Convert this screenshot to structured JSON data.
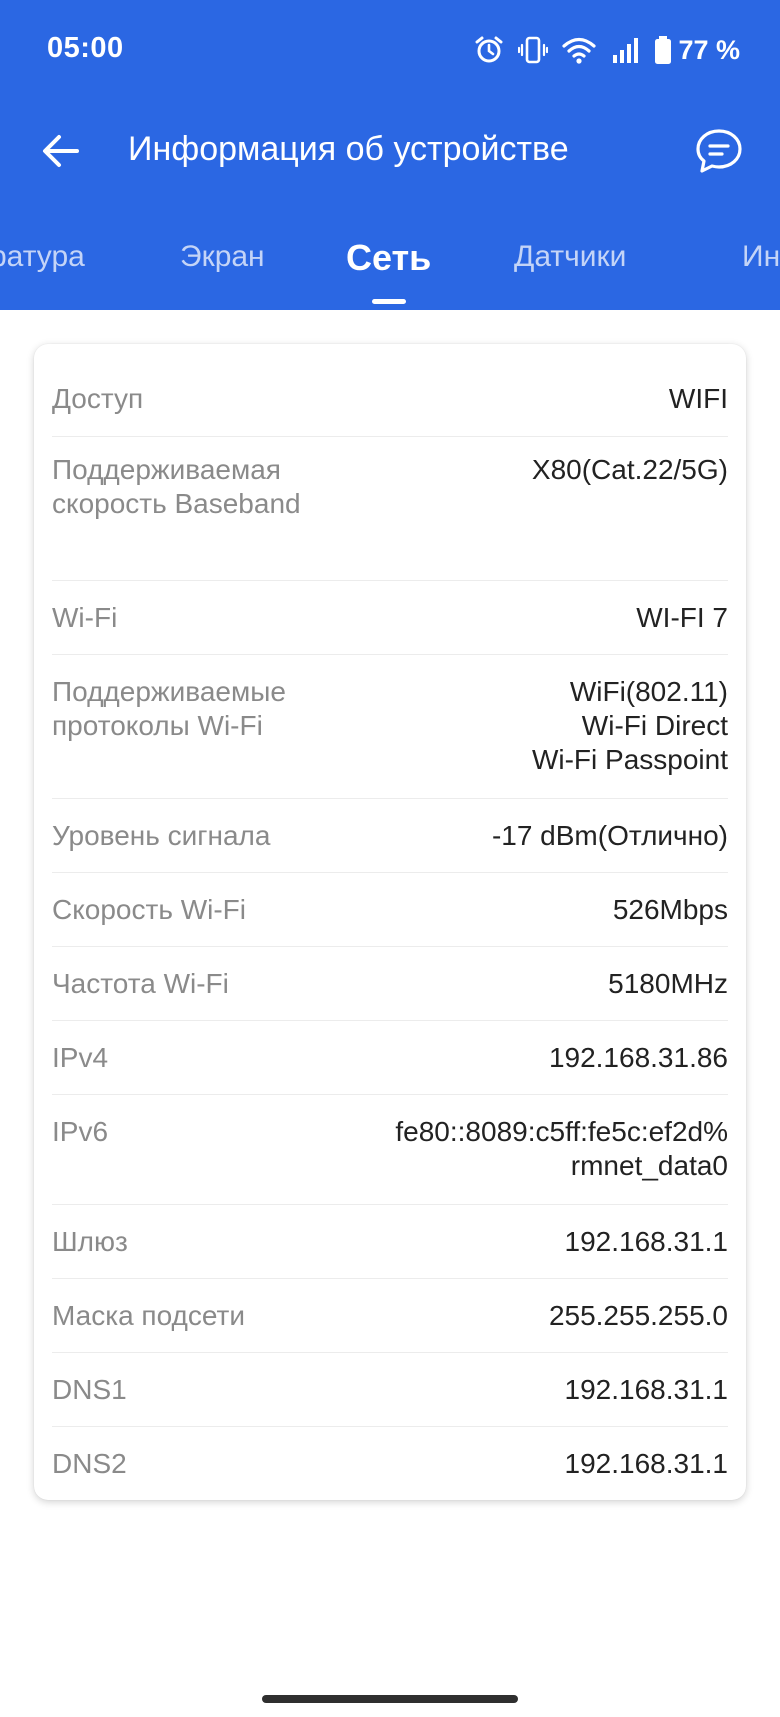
{
  "status_bar": {
    "time": "05:00",
    "battery": "77 %"
  },
  "header": {
    "title": "Информация об устройстве"
  },
  "tabs": [
    {
      "label": "ратура"
    },
    {
      "label": "Экран"
    },
    {
      "label": "Сеть"
    },
    {
      "label": "Датчики"
    },
    {
      "label": "Ин"
    }
  ],
  "active_tab": "Сеть",
  "colors": {
    "accent": "#2b67e3",
    "label_gray": "#8a8a8a",
    "value_text": "#222222"
  },
  "rows": [
    {
      "label": "Доступ",
      "value": "WIFI"
    },
    {
      "label": "Поддерживаемая скорость Baseband",
      "value": "X80(Cat.22/5G)"
    },
    {
      "label": "Wi-Fi",
      "value": "WI-FI 7"
    },
    {
      "label": "Поддерживаемые протоколы Wi-Fi",
      "value": "WiFi(802.11)\nWi-Fi Direct\nWi-Fi Passpoint"
    },
    {
      "label": "Уровень сигнала",
      "value": "-17 dBm(Отлично)"
    },
    {
      "label": "Скорость Wi-Fi",
      "value": "526Mbps"
    },
    {
      "label": "Частота Wi-Fi",
      "value": "5180MHz"
    },
    {
      "label": "IPv4",
      "value": "192.168.31.86"
    },
    {
      "label": "IPv6",
      "value": "fe80::8089:c5ff:fe5c:ef2d%\nrmnet_data0"
    },
    {
      "label": "Шлюз",
      "value": "192.168.31.1"
    },
    {
      "label": "Маска подсети",
      "value": "255.255.255.0"
    },
    {
      "label": "DNS1",
      "value": "192.168.31.1"
    },
    {
      "label": "DNS2",
      "value": "192.168.31.1"
    }
  ],
  "icons": [
    "alarm-icon",
    "vibrate-icon",
    "wifi-icon",
    "signal-icon",
    "battery-icon",
    "back-arrow-icon",
    "chat-feedback-icon"
  ]
}
